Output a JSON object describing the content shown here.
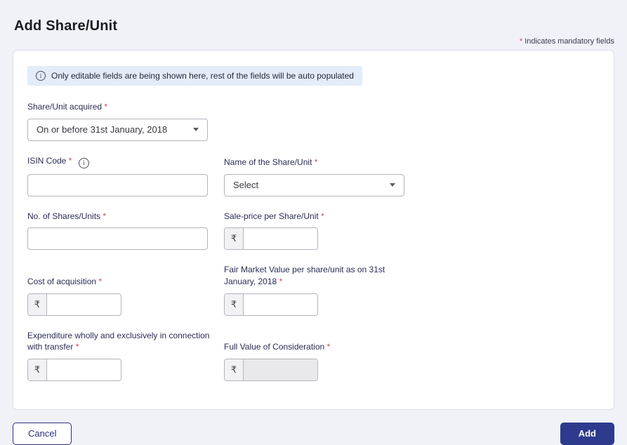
{
  "page": {
    "title": "Add Share/Unit",
    "mandatory_note": {
      "asterisk": "*",
      "text": " Indicates mandatory fields"
    }
  },
  "banner": {
    "icon": "info-icon",
    "text": "Only editable fields are being shown here, rest of the fields will be auto populated"
  },
  "fields": {
    "share_unit_acquired": {
      "label": "Share/Unit acquired ",
      "required": "*",
      "value": "On or before 31st January, 2018",
      "type": "select"
    },
    "isin_code": {
      "label": "ISIN Code ",
      "required": "*",
      "value": "",
      "info_icon": "info-icon",
      "type": "text"
    },
    "name_of_share_unit": {
      "label": "Name of the Share/Unit ",
      "required": "*",
      "value": "Select",
      "type": "select"
    },
    "no_of_shares_units": {
      "label": "No. of Shares/Units ",
      "required": "*",
      "value": "",
      "type": "text"
    },
    "sale_price_per_share_unit": {
      "label": "Sale-price per Share/Unit ",
      "required": "*",
      "currency": "₹",
      "value": "",
      "type": "currency"
    },
    "cost_of_acquisition": {
      "label": "Cost of acquisition ",
      "required": "*",
      "currency": "₹",
      "value": "",
      "type": "currency"
    },
    "fair_market_value": {
      "label": "Fair Market Value per share/unit as on 31st January, 2018 ",
      "required": "*",
      "currency": "₹",
      "value": "",
      "type": "currency"
    },
    "expenditure_transfer": {
      "label": "Expenditure wholly and exclusively in connection with transfer ",
      "required": "*",
      "currency": "₹",
      "value": "",
      "type": "currency"
    },
    "full_value_consideration": {
      "label": "Full Value of Consideration ",
      "required": "*",
      "currency": "₹",
      "value": "",
      "type": "currency",
      "disabled": true
    }
  },
  "actions": {
    "cancel_label": "Cancel",
    "add_label": "Add"
  },
  "colors": {
    "accent": "#2e3a8e",
    "required_marker": "#d54557",
    "banner_background": "#e3ecf8",
    "page_background": "#f1f2f8",
    "input_border": "#b3b3bd"
  }
}
